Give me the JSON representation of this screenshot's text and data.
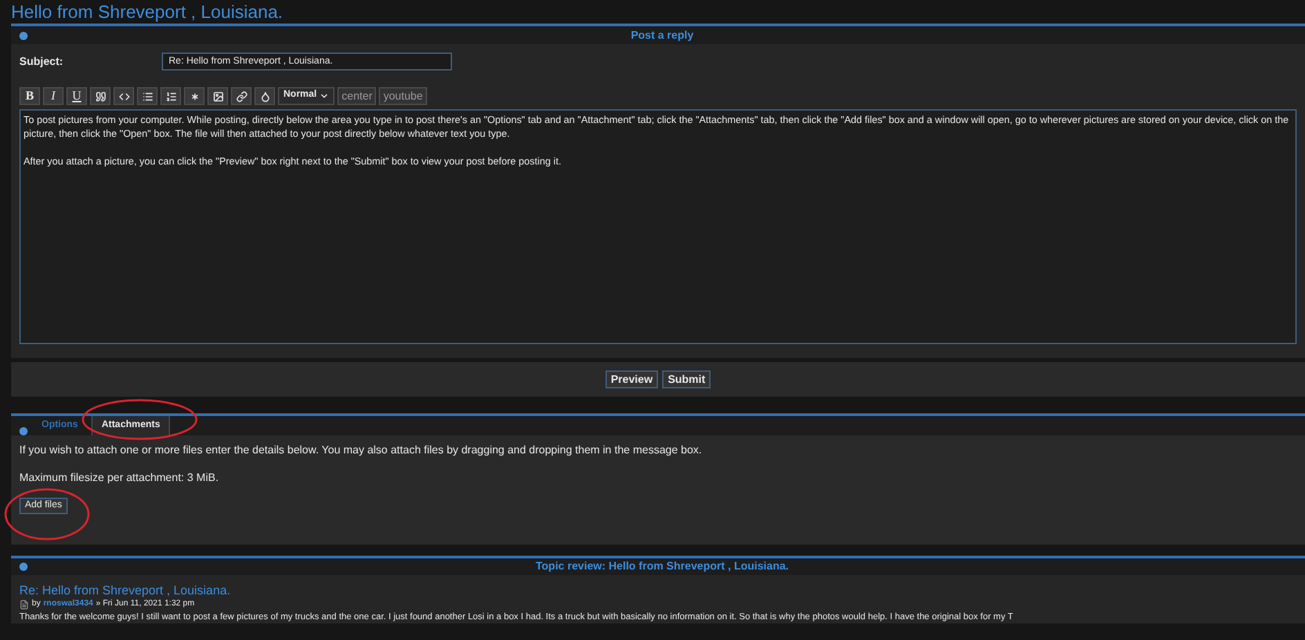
{
  "page_title": "Hello from Shreveport , Louisiana.",
  "reply_panel": {
    "header": "Post a reply",
    "subject": {
      "label": "Subject:",
      "value": "Re: Hello from Shreveport , Louisiana."
    },
    "format_buttons": [
      "B",
      "I",
      "U"
    ],
    "size_select": "Normal",
    "tag_buttons": [
      "center",
      "youtube"
    ],
    "message": [
      "To post pictures from your computer.  While posting, directly below the area you type in to post there's an \"Options\" tab and an \"Attachment\" tab; click the \"Attachments\" tab, then click the \"Add files\" box and a window will open, go to wherever pictures are stored on your device, click on the picture, then click the \"Open\" box.  The file will then attached to your post directly below whatever text you type.",
      "After you attach a picture, you can click the \"Preview\" box right next to the \"Submit\" box to view your post before posting it."
    ],
    "buttons": [
      "Preview",
      "Submit"
    ]
  },
  "tabs": [
    {
      "label": "Options",
      "selected": false
    },
    {
      "label": "Attachments",
      "selected": true
    }
  ],
  "attachments": {
    "info": "If you wish to attach one or more files enter the details below. You may also attach files by dragging and dropping them in the message box.",
    "max_size": "Maximum filesize per attachment: 3 MiB.",
    "add_button": "Add files"
  },
  "topic_review": {
    "header": "Topic review: Hello from Shreveport , Louisiana.",
    "post_title": "Re: Hello from Shreveport , Louisiana.",
    "by": "by",
    "author": "rnoswal3434",
    "date": "» Fri Jun 11, 2021 1:32 pm",
    "text": "Thanks for the welcome guys! I still want to post a few pictures of my trucks and the one car. I just found another Losi in a box I had. Its a truck but with basically no information on it. So that is why the photos would help. I have the original box for my T"
  }
}
